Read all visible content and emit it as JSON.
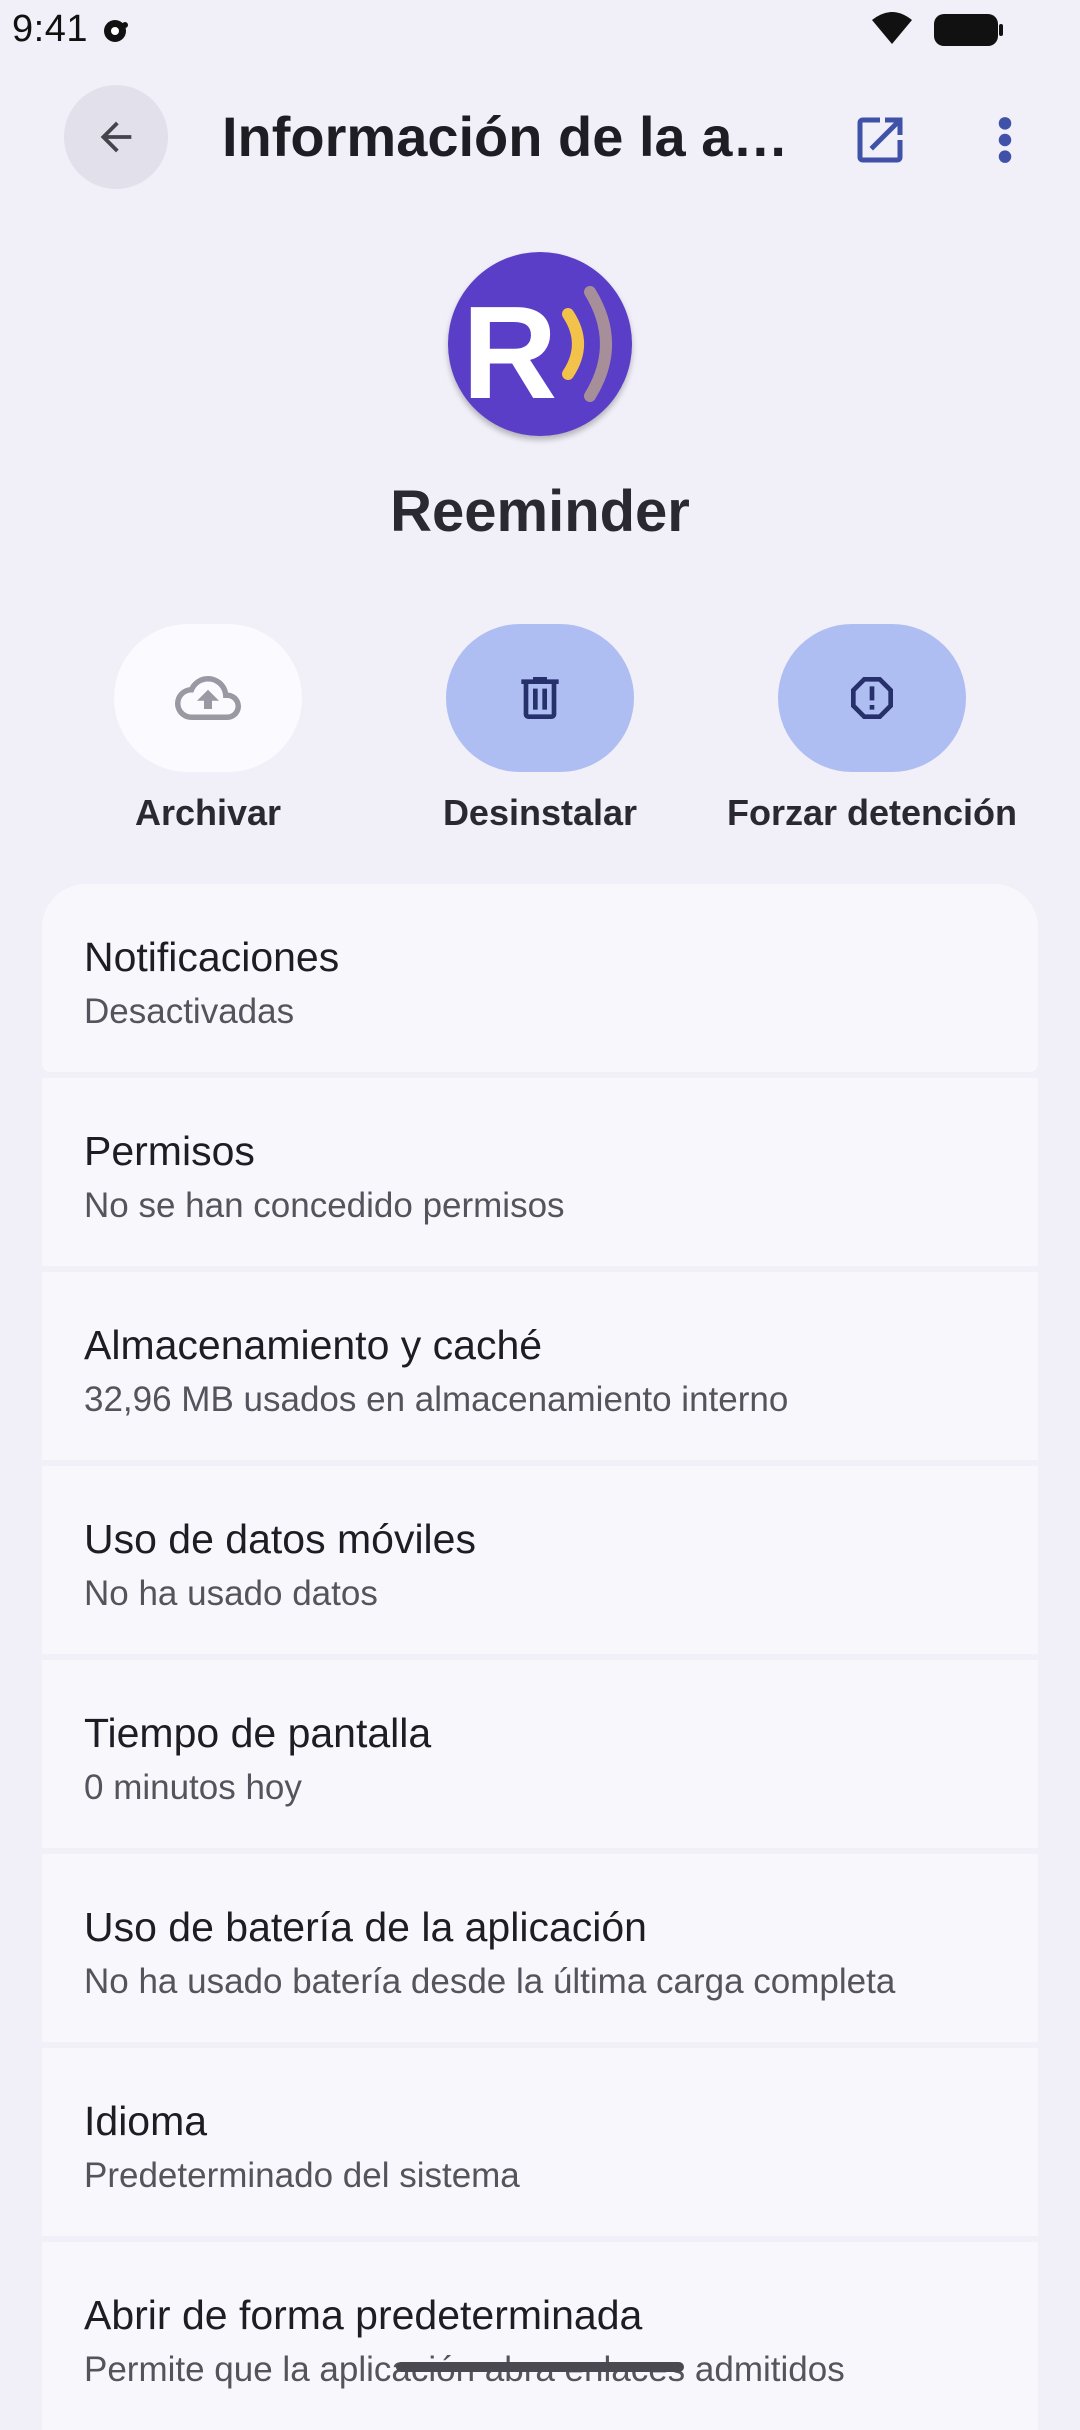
{
  "status_bar": {
    "time": "9:41"
  },
  "app_bar": {
    "title": "Información de la a…"
  },
  "app": {
    "name": "Reeminder",
    "icon_letter": "R"
  },
  "actions": [
    {
      "label": "Archivar",
      "icon": "cloud-upload-icon"
    },
    {
      "label": "Desinstalar",
      "icon": "trash-icon"
    },
    {
      "label": "Forzar detención",
      "icon": "alert-icon"
    }
  ],
  "settings": [
    {
      "title": "Notificaciones",
      "subtitle": "Desactivadas"
    },
    {
      "title": "Permisos",
      "subtitle": "No se han concedido permisos"
    },
    {
      "title": "Almacenamiento y caché",
      "subtitle": "32,96 MB usados en almacenamiento interno"
    },
    {
      "title": "Uso de datos móviles",
      "subtitle": "No ha usado datos"
    },
    {
      "title": "Tiempo de pantalla",
      "subtitle": "0 minutos hoy"
    },
    {
      "title": "Uso de batería de la aplicación",
      "subtitle": "No ha usado batería desde la última carga completa"
    },
    {
      "title": "Idioma",
      "subtitle": "Predeterminado del sistema"
    },
    {
      "title": "Abrir de forma predeterminada",
      "subtitle": "Permite que la aplicación abra enlaces admitidos"
    }
  ],
  "colors": {
    "background": "#f1eff8",
    "card": "#f8f7fc",
    "accent_button": "#aebef2",
    "app_icon": "#5a3ec8"
  }
}
